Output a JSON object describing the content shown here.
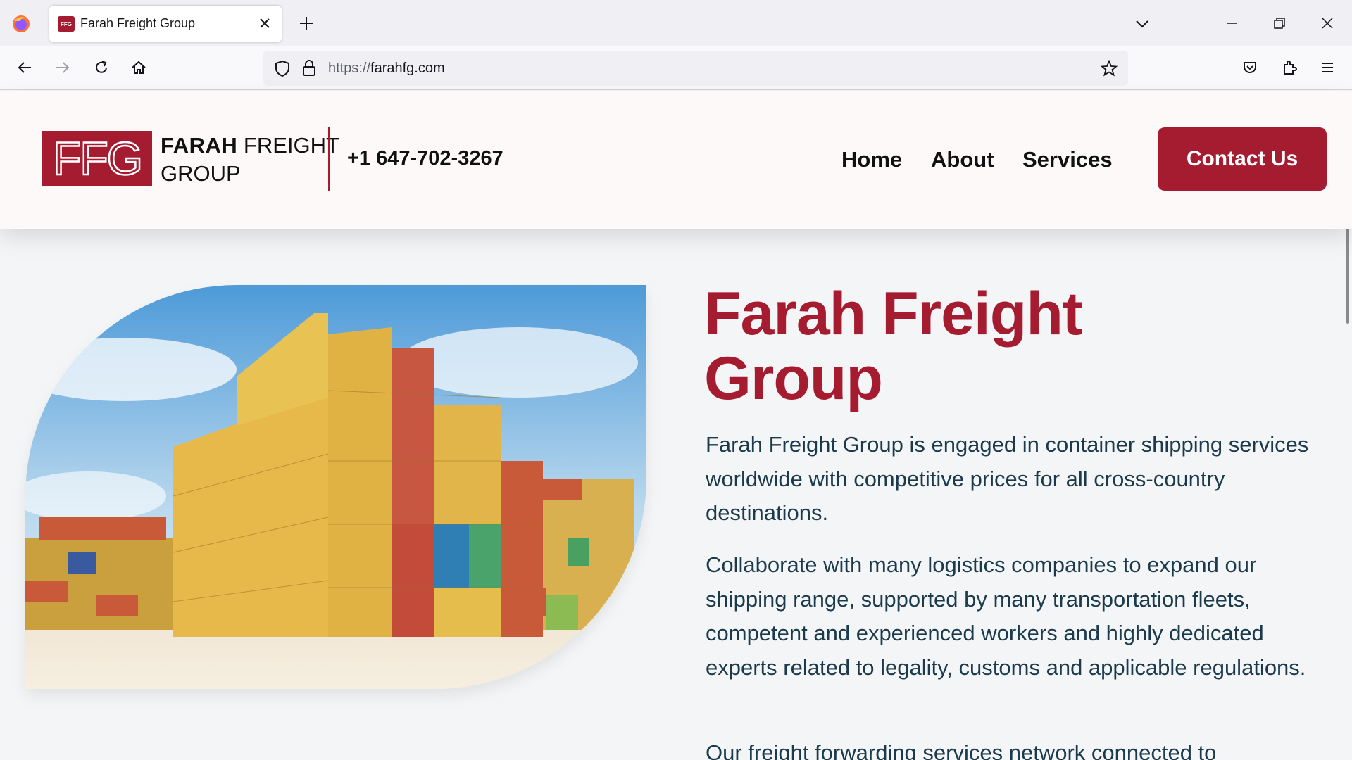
{
  "browser": {
    "tab_title": "Farah Freight Group",
    "tab_favicon_text": "FFG",
    "url_protocol": "https://",
    "url_host": "farahfg.com",
    "icons": {
      "back": "back-arrow-icon",
      "forward": "forward-arrow-icon",
      "reload": "reload-icon",
      "home": "home-icon",
      "tracking": "shield-icon",
      "lock": "lock-icon",
      "bookmark": "star-icon",
      "pocket": "pocket-icon",
      "extensions": "puzzle-icon",
      "menu": "hamburger-menu-icon"
    }
  },
  "header": {
    "logo_text": "FFG",
    "brand_line1_bold": "FARAH",
    "brand_line1_rest": " FREIGHT",
    "brand_line2": "GROUP",
    "phone": "+1 647-702-3267",
    "nav": [
      "Home",
      "About",
      "Services"
    ],
    "contact_button": "Contact Us",
    "accent_color": "#a51c30"
  },
  "hero": {
    "title_line1": "Farah Freight",
    "title_line2": "Group",
    "paragraphs": [
      "Farah Freight Group is engaged in container shipping services worldwide with competitive prices for all cross-country destinations.",
      "Collaborate with many logistics companies to expand our shipping range, supported by many transportation fleets, competent and experienced workers and highly dedicated experts related to legality, customs and applicable regulations.",
      "Our freight forwarding services network connected to"
    ],
    "text_color": "#1b3a4b"
  }
}
